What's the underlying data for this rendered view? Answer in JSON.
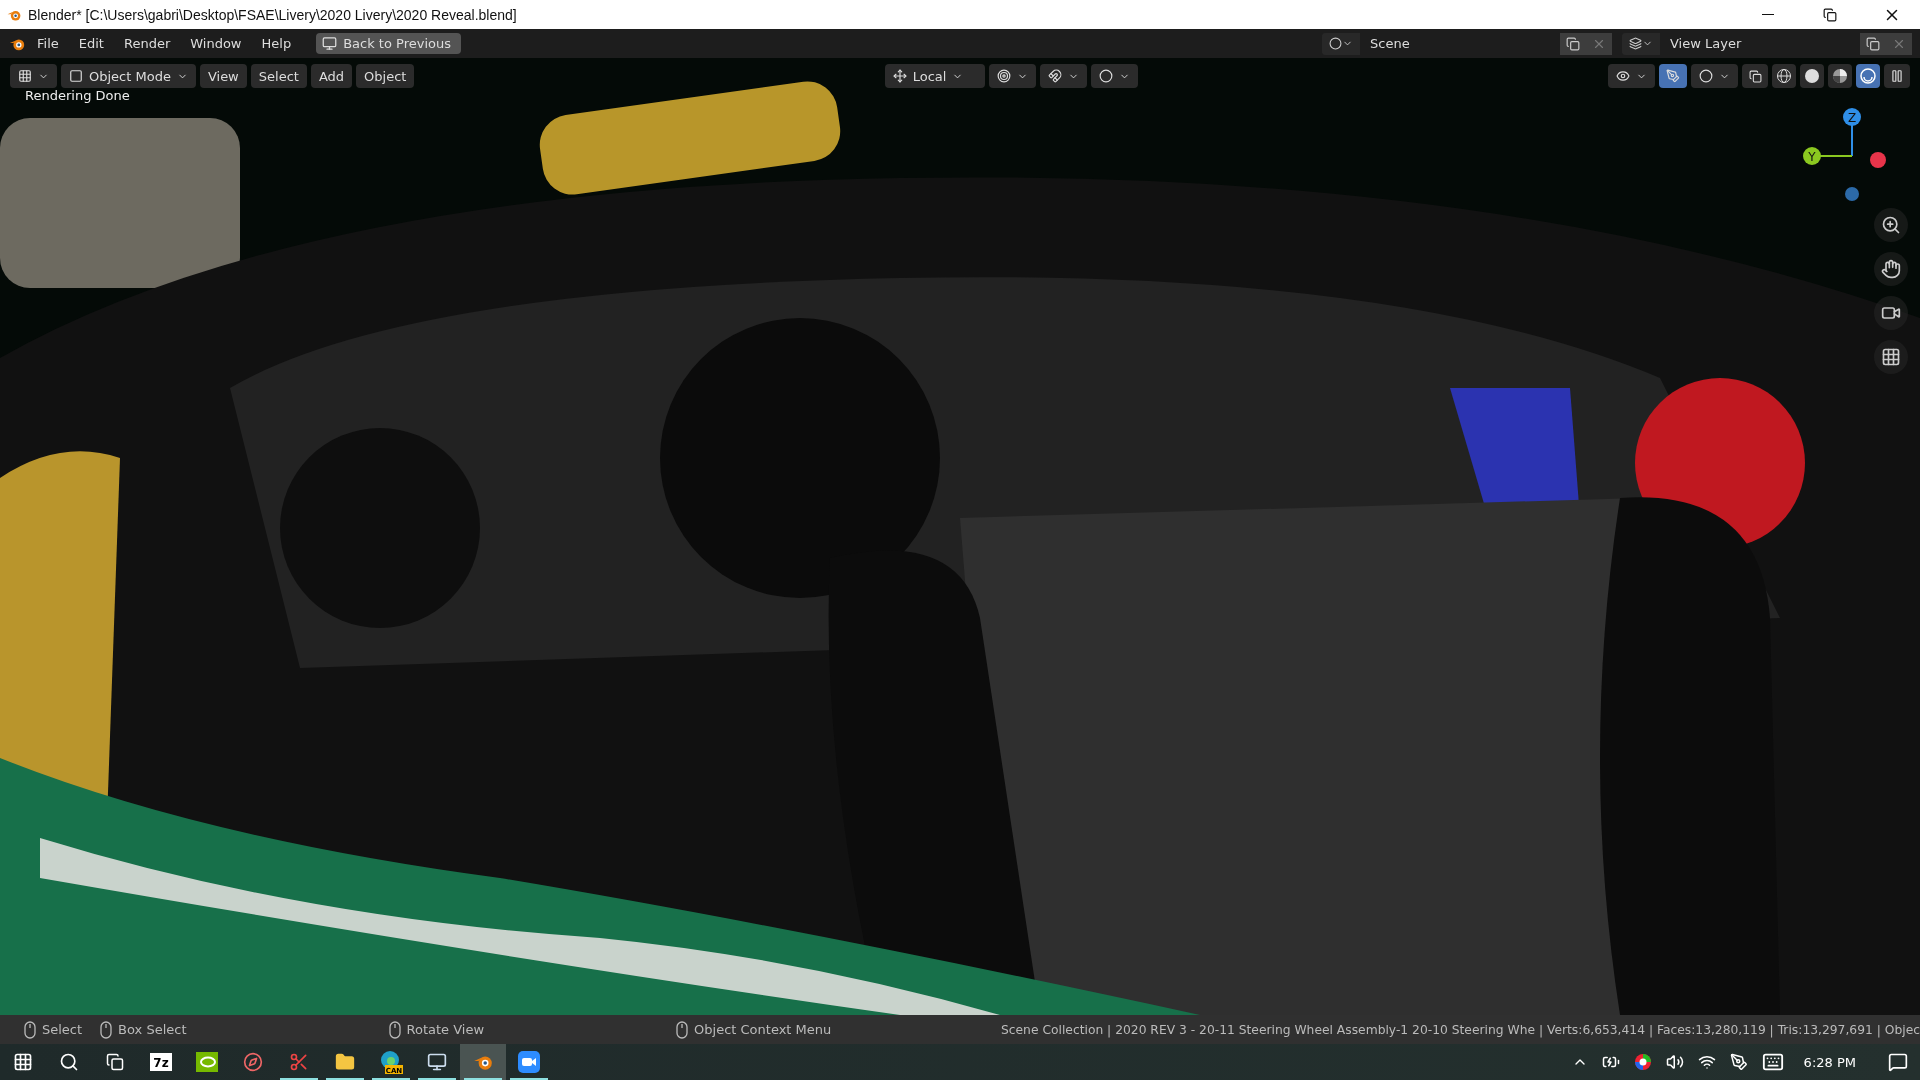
{
  "window": {
    "title": "Blender* [C:\\Users\\gabri\\Desktop\\FSAE\\Livery\\2020 Livery\\2020 Reveal.blend]"
  },
  "menu": [
    "File",
    "Edit",
    "Render",
    "Window",
    "Help"
  ],
  "back_button": "Back to Previous",
  "scene": "Scene",
  "view_layer": "View Layer",
  "header": {
    "mode": "Object Mode",
    "menus": [
      "View",
      "Select",
      "Add",
      "Object"
    ],
    "orientation": "Local",
    "gizmos_on": true,
    "shading": [
      {
        "kind": "wireframe",
        "selected": false
      },
      {
        "kind": "solid",
        "selected": false
      },
      {
        "kind": "material",
        "selected": false
      },
      {
        "kind": "rendered",
        "selected": true
      }
    ]
  },
  "viewport": {
    "info": "Rendering Done",
    "axes": [
      {
        "label": "Z",
        "color": "#2f8fe8"
      },
      {
        "label": "Y",
        "color": "#8bc820"
      }
    ]
  },
  "status_bar": {
    "hints": [
      "Select",
      "Box Select",
      "Rotate View",
      "Object Context Menu"
    ],
    "stats": "Scene Collection | 2020 REV 3 - 20-11 Steering Wheel Assembly-1 20-10 Steering Whe | Verts:6,653,414 | Faces:13,280,119 | Tris:13,297,691 | Objec"
  },
  "taskbar": {
    "apps": [
      {
        "kind": "archiver",
        "label": "7z",
        "running": false,
        "selected": false
      },
      {
        "kind": "gpu",
        "running": false,
        "selected": false
      },
      {
        "kind": "compass",
        "running": false,
        "selected": false
      },
      {
        "kind": "snip",
        "running": true,
        "selected": false
      },
      {
        "kind": "folder",
        "running": true,
        "selected": false
      },
      {
        "kind": "browser",
        "label": "CAN",
        "running": true,
        "selected": false
      },
      {
        "kind": "monitor",
        "running": true,
        "selected": false
      },
      {
        "kind": "blender",
        "running": true,
        "selected": true
      },
      {
        "kind": "video",
        "running": true,
        "selected": false
      }
    ],
    "time": "6:28 PM"
  }
}
